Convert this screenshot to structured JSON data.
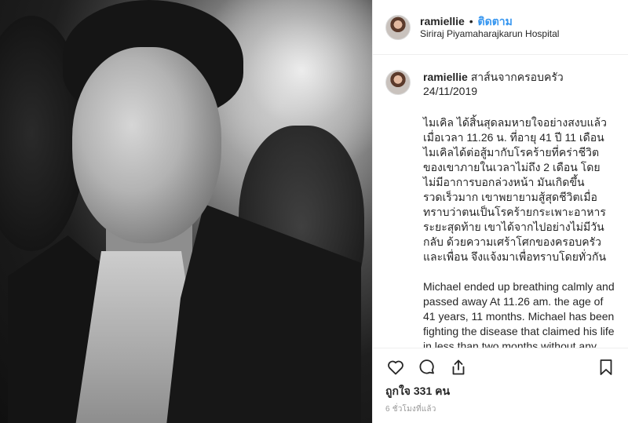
{
  "header": {
    "username": "ramiellie",
    "separator": "•",
    "follow_label": "ติดตาม",
    "location": "Siriraj Piyamaharajkarun Hospital"
  },
  "comment": {
    "username": "ramiellie",
    "title": "สาส์นจากครอบครัว",
    "date": "24/11/2019",
    "thai_text": "ไมเคิล ได้สิ้นสุดลมหายใจอย่างสงบแล้ว เมื่อเวลา 11.26 น. ที่อายุ 41 ปี 11 เดือน ไมเคิลได้ต่อสู้มากับโรคร้ายที่คร่าชีวิตของเขาภายในเวลาไม่ถึง 2 เดือน โดยไม่มีอาการบอกล่วงหน้า มันเกิดขึ้นรวดเร็วมาก เขาพยายามสู้สุดชีวิตเมื่อทราบว่าตนเป็นโรคร้ายกระเพาะอาหารระยะสุดท้าย เขาได้จากไปอย่างไม่มีวันกลับ ด้วยความเศร้าโศกของครอบครัวและเพื่อน จึงแจ้งมาเพื่อทราบโดยทั่วกัน",
    "english_text": "Michael ended up breathing calmly and passed away At 11.26 am. the age of 41 years, 11 months. Michael has been fighting the disease that claimed his life in less than two months without any signs foretold. It"
  },
  "actions": {
    "like_icon": "heart-icon",
    "comment_icon": "comment-icon",
    "share_icon": "share-icon",
    "save_icon": "bookmark-icon"
  },
  "likes_text": "ถูกใจ 331 คน",
  "time_text": "6 ชั่วโมงที่แล้ว",
  "colors": {
    "accent": "#3897f0",
    "text": "#262626",
    "muted": "#999999",
    "divider": "#efefef"
  }
}
